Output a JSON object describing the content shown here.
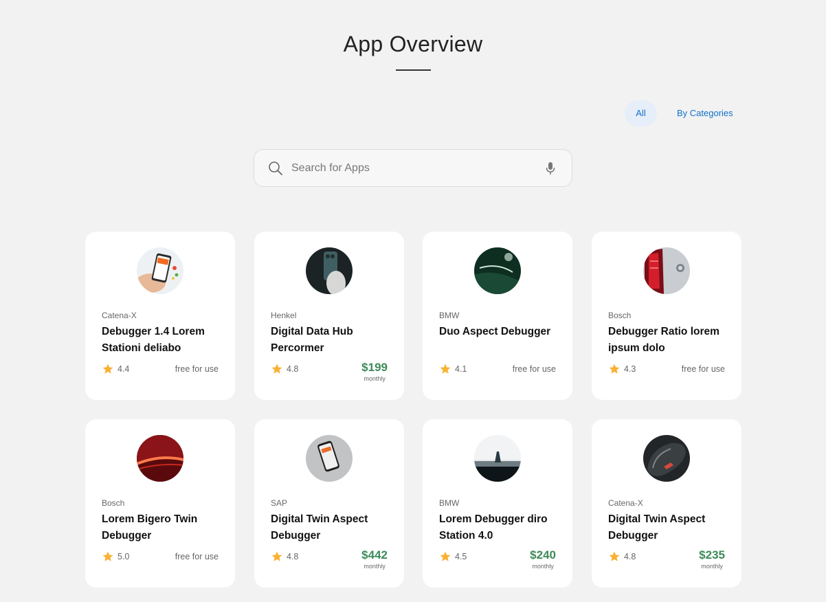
{
  "page": {
    "title": "App Overview"
  },
  "filters": {
    "all_label": "All",
    "categories_label": "By Categories"
  },
  "search": {
    "placeholder": "Search for Apps"
  },
  "apps": [
    {
      "provider": "Catena-X",
      "name": "Debugger 1.4 Lorem Stationi deliabo",
      "rating": "4.4",
      "price": "free for use",
      "period": ""
    },
    {
      "provider": "Henkel",
      "name": "Digital Data Hub Percormer",
      "rating": "4.8",
      "price": "$199",
      "period": "monthly"
    },
    {
      "provider": "BMW",
      "name": "Duo Aspect Debugger",
      "rating": "4.1",
      "price": "free for use",
      "period": ""
    },
    {
      "provider": "Bosch",
      "name": "Debugger Ratio lorem ipsum dolo",
      "rating": "4.3",
      "price": "free for use",
      "period": ""
    },
    {
      "provider": "Bosch",
      "name": "Lorem  Bigero Twin Debugger",
      "rating": "5.0",
      "price": "free for use",
      "period": ""
    },
    {
      "provider": "SAP",
      "name": "Digital Twin Aspect Debugger",
      "rating": "4.8",
      "price": "$442",
      "period": "monthly"
    },
    {
      "provider": "BMW",
      "name": "Lorem Debugger diro Station 4.0",
      "rating": "4.5",
      "price": "$240",
      "period": "monthly"
    },
    {
      "provider": "Catena-X",
      "name": "Digital Twin Aspect Debugger",
      "rating": "4.8",
      "price": "$235",
      "period": "monthly"
    }
  ],
  "colors": {
    "accent": "#0f71cb",
    "price": "#3d8a59",
    "star": "#f8b133",
    "background": "#f2f2f2"
  },
  "icons": {
    "search": "search-icon",
    "mic": "microphone-icon",
    "star": "star-icon"
  }
}
